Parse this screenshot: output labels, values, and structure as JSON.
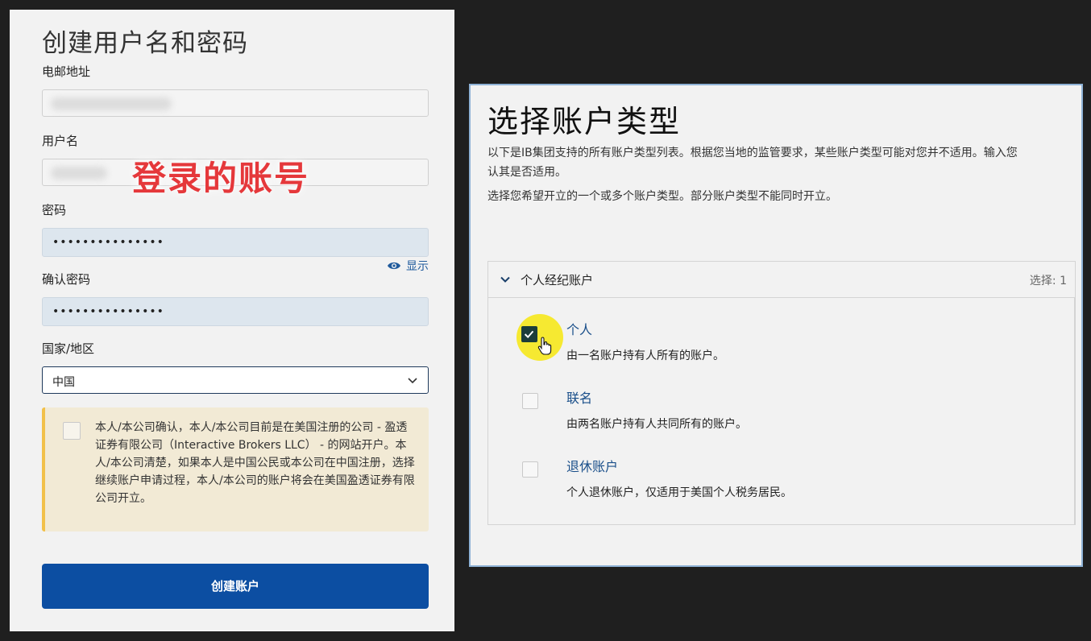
{
  "left": {
    "title": "创建用户名和密码",
    "email_label": "电邮地址",
    "username_label": "用户名",
    "password_label": "密码",
    "password_value": "•••••••••••••••",
    "show_label": "显示",
    "confirm_label": "确认密码",
    "confirm_value": "•••••••••••••••",
    "country_label": "国家/地区",
    "country_value": "中国",
    "overlay_annotation": "登录的账号",
    "notice_text": "本人/本公司确认，本人/本公司目前是在美国注册的公司 - 盈透证券有限公司（Interactive Brokers LLC） - 的网站开户。本人/本公司清楚，如果本人是中国公民或本公司在中国注册，选择继续账户申请过程，本人/本公司的账户将会在美国盈透证券有限公司开立。",
    "create_button": "创建账户"
  },
  "right": {
    "title": "选择账户类型",
    "desc1_line1": "以下是IB集团支持的所有账户类型列表。根据您当地的监管要求，某些账户类型可能对您并不适用。输入您",
    "desc1_line2": "认其是否适用。",
    "desc2": "选择您希望开立的一个或多个账户类型。部分账户类型不能同时开立。",
    "section_title": "个人经纪账户",
    "section_count": "选择: 1",
    "items": [
      {
        "title": "个人",
        "desc": "由一名账户持有人所有的账户。",
        "checked": true
      },
      {
        "title": "联名",
        "desc": "由两名账户持有人共同所有的账户。",
        "checked": false
      },
      {
        "title": "退休账户",
        "desc": "个人退休账户，仅适用于美国个人税务居民。",
        "checked": false
      }
    ]
  },
  "colors": {
    "primary_button": "#0c4ea2",
    "link": "#1a4f8a",
    "annotation_red": "#e5383b",
    "notice_bg": "#f2ead5",
    "notice_border": "#f2c14a",
    "highlight_yellow": "#f5e826"
  }
}
